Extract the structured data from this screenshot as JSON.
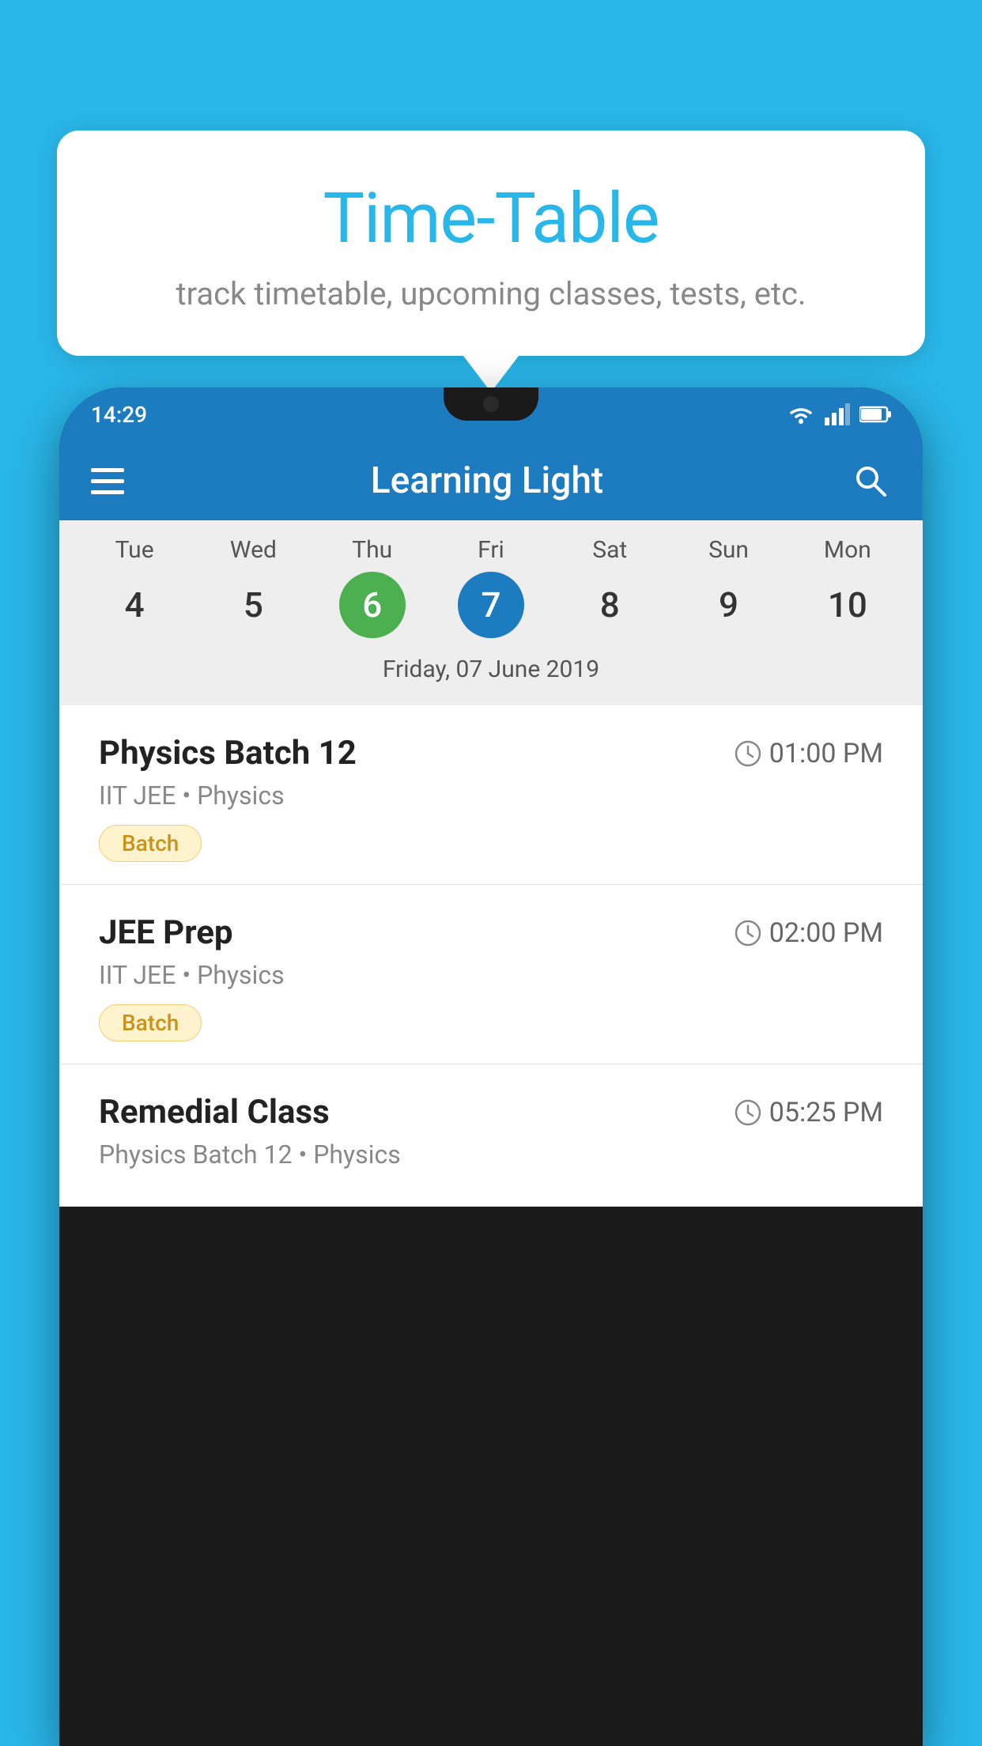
{
  "background_color": "#29B6E8",
  "bubble": {
    "title": "Time-Table",
    "subtitle": "track timetable, upcoming classes, tests, etc."
  },
  "phone": {
    "status_bar": {
      "time": "14:29"
    },
    "app_bar": {
      "title": "Learning Light",
      "menu_icon": "hamburger-icon",
      "search_icon": "search-icon"
    },
    "calendar": {
      "selected_date_label": "Friday, 07 June 2019",
      "days": [
        {
          "name": "Tue",
          "num": "4",
          "state": "normal"
        },
        {
          "name": "Wed",
          "num": "5",
          "state": "normal"
        },
        {
          "name": "Thu",
          "num": "6",
          "state": "today"
        },
        {
          "name": "Fri",
          "num": "7",
          "state": "selected"
        },
        {
          "name": "Sat",
          "num": "8",
          "state": "normal"
        },
        {
          "name": "Sun",
          "num": "9",
          "state": "normal"
        },
        {
          "name": "Mon",
          "num": "10",
          "state": "normal"
        }
      ]
    },
    "schedule": [
      {
        "title": "Physics Batch 12",
        "time": "01:00 PM",
        "subtitle": "IIT JEE • Physics",
        "badge": "Batch"
      },
      {
        "title": "JEE Prep",
        "time": "02:00 PM",
        "subtitle": "IIT JEE • Physics",
        "badge": "Batch"
      },
      {
        "title": "Remedial Class",
        "time": "05:25 PM",
        "subtitle": "Physics Batch 12 • Physics",
        "badge": null
      }
    ]
  }
}
